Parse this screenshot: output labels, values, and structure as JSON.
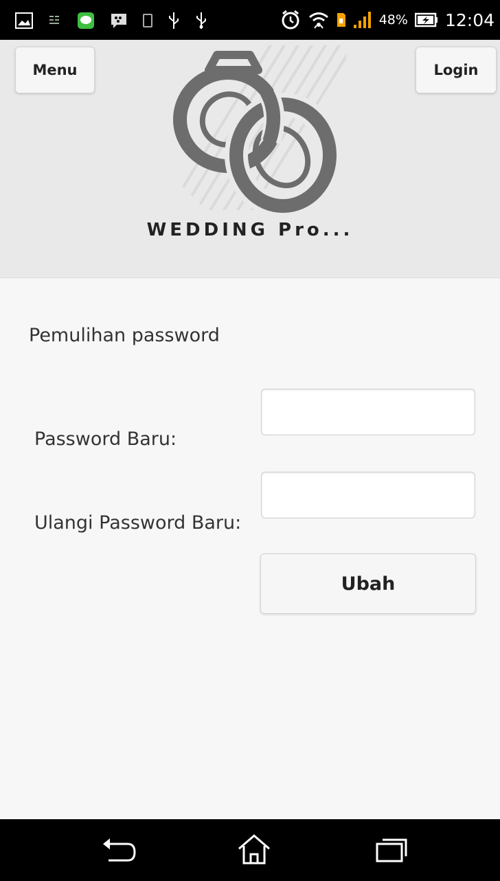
{
  "status_bar": {
    "battery_percent": "48%",
    "time": "12:04",
    "icons": [
      "gallery-icon",
      "sim-toolkit-icon",
      "line-icon",
      "bbm-icon",
      "phone-outline-icon",
      "usb-icon",
      "usb-debug-icon",
      "alarm-icon",
      "wifi-icon",
      "sim-icon",
      "signal-icon",
      "battery-charging-icon"
    ]
  },
  "header": {
    "menu_label": "Menu",
    "login_label": "Login",
    "logo_icon": "wedding-rings-logo",
    "app_title": "WEDDING Pro..."
  },
  "form": {
    "heading": "Pemulihan password",
    "new_password_label": "Password Baru:",
    "new_password_value": "",
    "repeat_password_label": "Ulangi Password Baru:",
    "repeat_password_value": "",
    "submit_label": "Ubah"
  },
  "nav_bar": {
    "icons": [
      "back-icon",
      "home-icon",
      "recent-apps-icon"
    ]
  },
  "colors": {
    "header_bg": "#e9e9e9",
    "page_bg": "#f7f7f7",
    "logo": "#6d6d6d",
    "system_bars": "#000000"
  }
}
